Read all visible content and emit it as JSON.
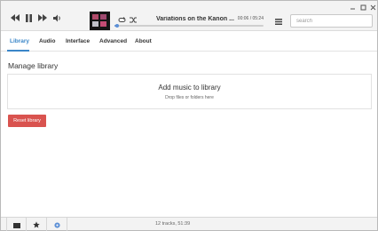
{
  "player": {
    "track_title": "Variations on the Kanon ...",
    "time": "00:06 / 05:24",
    "progress_fraction": 0.02
  },
  "search": {
    "placeholder": "search"
  },
  "tabs": [
    {
      "label": "Library",
      "active": true
    },
    {
      "label": "Audio",
      "active": false
    },
    {
      "label": "Interface",
      "active": false
    },
    {
      "label": "Advanced",
      "active": false
    },
    {
      "label": "About",
      "active": false
    }
  ],
  "library": {
    "title": "Manage library",
    "dropzone_title": "Add music to library",
    "dropzone_subtitle": "Drop files or folders here",
    "reset_label": "Reset library"
  },
  "status": {
    "text": "12 tracks, 51:39"
  },
  "colors": {
    "accent": "#3a86c8",
    "danger": "#d9534f",
    "progress": "#5b8fd6"
  },
  "icons": {
    "toolbar": [
      "skip-back-icon",
      "pause-icon",
      "skip-forward-icon",
      "volume-icon",
      "repeat-icon",
      "shuffle-icon",
      "queue-list-icon"
    ],
    "window": [
      "minimize-icon",
      "maximize-icon",
      "close-icon"
    ],
    "statusbar": [
      "playlist-icon",
      "star-icon",
      "settings-icon"
    ]
  }
}
